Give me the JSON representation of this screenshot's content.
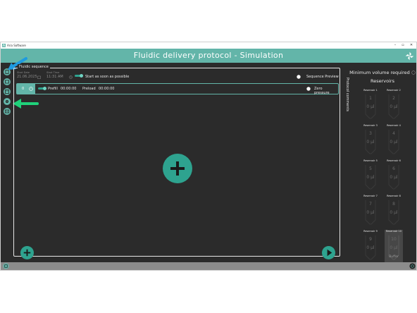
{
  "window": {
    "title": "Aria Software",
    "minimize": "–",
    "maximize": "▫",
    "close": "✕"
  },
  "header": {
    "title": "Fluidic delivery protocol - Simulation"
  },
  "sequence": {
    "panel_title": "Fluidic sequence",
    "start_date_label": "Start Date",
    "start_date": "21.06.2025",
    "start_time_label": "Start Time",
    "start_time": "11:31 AM",
    "start_asap": "Start as soon as possible",
    "sequence_preview": "Sequence Preview",
    "step": {
      "index": "0",
      "prefill_label": "Prefill",
      "prefill_time": "00:00:00",
      "preload_label": "Preload",
      "preload_time": "00:00:00",
      "zero_pressure": "Zero pressure"
    },
    "big_add": "+",
    "add": "+"
  },
  "right": {
    "protocol_comments": "Protocol comments",
    "min_volume": "Minimum volume required",
    "reservoirs_title": "Reservoirs",
    "reservoirs": [
      {
        "label": "Reservoir 1",
        "num": "1",
        "vol": "0 µl"
      },
      {
        "label": "Reservoir 2",
        "num": "2",
        "vol": "0 µl"
      },
      {
        "label": "Reservoir 3",
        "num": "3",
        "vol": "0 µl"
      },
      {
        "label": "Reservoir 4",
        "num": "4",
        "vol": "0 µl"
      },
      {
        "label": "Reservoir 5",
        "num": "5",
        "vol": "0 µl"
      },
      {
        "label": "Reservoir 6",
        "num": "6",
        "vol": "0 µl"
      },
      {
        "label": "Reservoir 7",
        "num": "7",
        "vol": "0 µl"
      },
      {
        "label": "Reservoir 8",
        "num": "8",
        "vol": "0 µl"
      },
      {
        "label": "Reservoir 9",
        "num": "9",
        "vol": "0 µl"
      },
      {
        "label": "Reservoir 10",
        "num": "10",
        "vol": "0 µl",
        "extra": "Buffer"
      }
    ]
  },
  "colors": {
    "accent": "#63b5a9",
    "button": "#2ea38f",
    "background": "#2b2b2b",
    "arrow_blue": "#1e9be0",
    "arrow_green": "#1fd17a"
  }
}
